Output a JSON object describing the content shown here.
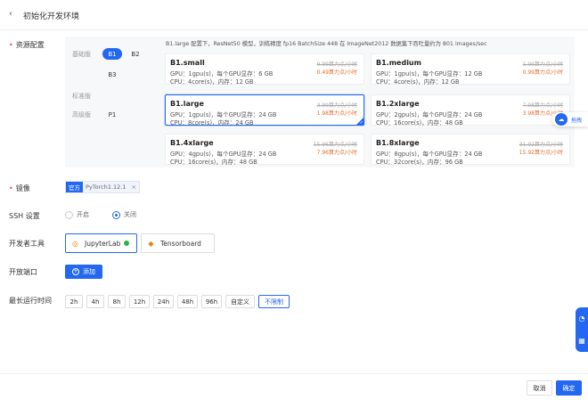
{
  "header": {
    "back_icon": "chevron-left-icon",
    "title": "初始化开发环境"
  },
  "resource": {
    "label": "资源配置",
    "tiers": [
      {
        "label": "基础版",
        "specs": [
          "B1",
          "B2",
          "B3"
        ],
        "selected": "B1"
      },
      {
        "label": "标准版",
        "specs": []
      },
      {
        "label": "高级版",
        "specs": [
          "P1"
        ]
      }
    ],
    "perf_note": "B1.large 配置下，ResNet50 模型，训练精度 fp16 BatchSize 448 在 ImageNet2012 数据集下吞吐量约为 801 images/sec",
    "cards": [
      {
        "name": "B1.small",
        "gpu": "GPU：1gpu(s)，每个GPU显存：6 GB",
        "cpu": "CPU：4core(s)，内存：12 GB",
        "old_price": "9.99算力点/小时",
        "new_price": "0.49算力点/小时",
        "selected": false
      },
      {
        "name": "B1.medium",
        "gpu": "GPU：1gpu(s)，每个GPU显存：12 GB",
        "cpu": "CPU：4core(s)，内存：12 GB",
        "old_price": "1.99算力点/小时",
        "new_price": "0.99算力点/小时",
        "selected": false
      },
      {
        "name": "B1.large",
        "gpu": "GPU：1gpu(s)，每个GPU显存：24 GB",
        "cpu": "CPU：8core(s)，内存：24 GB",
        "old_price": "3.99算力点/小时",
        "new_price": "1.98算力点/小时",
        "selected": true
      },
      {
        "name": "B1.2xlarge",
        "gpu": "GPU：2gpu(s)，每个GPU显存：24 GB",
        "cpu": "CPU：16core(s)，内存：48 GB",
        "old_price": "7.98算力点/小时",
        "new_price": "3.98算力点/小时",
        "selected": false
      },
      {
        "name": "B1.4xlarge",
        "gpu": "GPU：4gpu(s)，每个GPU显存：24 GB",
        "cpu": "CPU：16core(s)，内存：48 GB",
        "old_price": "15.96算力点/小时",
        "new_price": "7.96算力点/小时",
        "selected": false
      },
      {
        "name": "B1.8xlarge",
        "gpu": "GPU：8gpu(s)，每个GPU显存：24 GB",
        "cpu": "CPU：32core(s)，内存：96 GB",
        "old_price": "31.92算力点/小时",
        "new_price": "15.92算力点/小时",
        "selected": false
      }
    ]
  },
  "image": {
    "label": "镜像",
    "badge": "官方",
    "version": "PyTorch1.12.1",
    "close_icon": "close-icon"
  },
  "ssh": {
    "label": "SSH 设置",
    "options": [
      "开启",
      "关闭"
    ],
    "selected": "关闭"
  },
  "devtools": {
    "label": "开发者工具",
    "items": [
      {
        "name": "JupyterLab",
        "icon": "jupyter-icon",
        "active": true
      },
      {
        "name": "Tensorboard",
        "icon": "tensorboard-icon",
        "active": false
      }
    ]
  },
  "ports": {
    "label": "开放端口",
    "add_label": "添加",
    "add_icon": "plus-circle-icon"
  },
  "runtime": {
    "label": "最长运行时间",
    "options": [
      "2h",
      "4h",
      "8h",
      "12h",
      "24h",
      "48h",
      "96h",
      "自定义",
      "不限制"
    ],
    "selected": "不限制"
  },
  "side": {
    "float_label": "拖拽",
    "float_icon": "cloud-icon"
  },
  "footer": {
    "cancel": "取消",
    "confirm": "确定"
  },
  "colors": {
    "primary": "#2468f2",
    "price_new": "#e36b2c",
    "required": "#e24b4b"
  }
}
